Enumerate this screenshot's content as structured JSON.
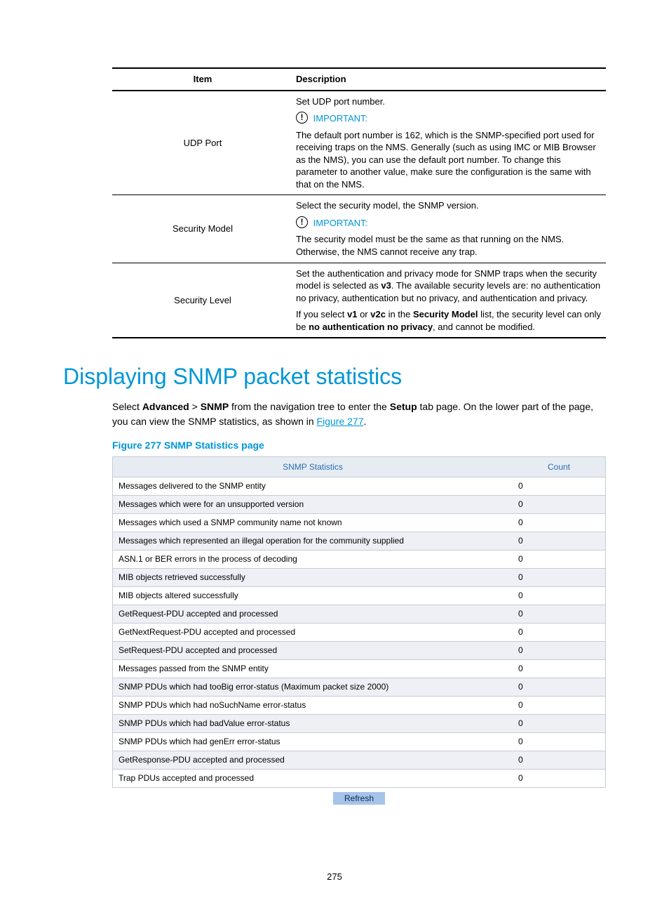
{
  "table1": {
    "headers": {
      "item": "Item",
      "desc": "Description"
    },
    "rows": [
      {
        "item": "UDP Port",
        "set": "Set UDP port number.",
        "imp": "IMPORTANT:",
        "body": "The default port number is 162, which is the SNMP-specified port used for receiving traps on the NMS. Generally (such as using IMC or MIB Browser as the NMS), you can use the default port number. To change this parameter to another value, make sure the configuration is the same with that on the NMS."
      },
      {
        "item": "Security Model",
        "set": "Select the security model, the SNMP version.",
        "imp": "IMPORTANT:",
        "body": "The security model must be the same as that running on the NMS. Otherwise, the NMS cannot receive any trap."
      },
      {
        "item": "Security Level",
        "b1a": "Set the authentication and privacy mode for SNMP traps when the security model is selected as ",
        "b1b_bold": "v3",
        "b1c": ". The available security levels are: no authentication no privacy, authentication but no privacy, and authentication and privacy.",
        "b2a": "If you select ",
        "b2b_bold": "v1",
        "b2c": " or ",
        "b2d_bold": "v2c",
        "b2e": " in the ",
        "b2f_bold": "Security Model",
        "b2g": " list, the security level can only be ",
        "b2h_bold": "no authentication no privacy",
        "b2i": ", and cannot be modified."
      }
    ]
  },
  "section_heading": "Displaying SNMP packet statistics",
  "paragraph": {
    "a": "Select ",
    "b_bold": "Advanced",
    "c": " > ",
    "d_bold": "SNMP",
    "e": " from the navigation tree to enter the ",
    "f_bold": "Setup",
    "g": " tab page. On the lower part of the page, you can view the SNMP statistics, as shown in ",
    "h_link": "Figure 277",
    "i": "."
  },
  "figure_caption": "Figure 277 SNMP Statistics page",
  "stats": {
    "headers": {
      "name": "SNMP Statistics",
      "count": "Count"
    },
    "rows": [
      {
        "name": "Messages delivered to the SNMP entity",
        "count": "0"
      },
      {
        "name": "Messages which were for an unsupported version",
        "count": "0"
      },
      {
        "name": "Messages which used a SNMP community name not known",
        "count": "0"
      },
      {
        "name": "Messages which represented an illegal operation for the community supplied",
        "count": "0"
      },
      {
        "name": "ASN.1 or BER errors in the process of decoding",
        "count": "0"
      },
      {
        "name": "MIB objects retrieved successfully",
        "count": "0"
      },
      {
        "name": "MIB objects altered successfully",
        "count": "0"
      },
      {
        "name": "GetRequest-PDU accepted and processed",
        "count": "0"
      },
      {
        "name": "GetNextRequest-PDU accepted and processed",
        "count": "0"
      },
      {
        "name": "SetRequest-PDU accepted and processed",
        "count": "0"
      },
      {
        "name": "Messages passed from the SNMP entity",
        "count": "0"
      },
      {
        "name": "SNMP PDUs which had tooBig error-status (Maximum packet size 2000)",
        "count": "0"
      },
      {
        "name": "SNMP PDUs which had noSuchName error-status",
        "count": "0"
      },
      {
        "name": "SNMP PDUs which had badValue error-status",
        "count": "0"
      },
      {
        "name": "SNMP PDUs which had genErr error-status",
        "count": "0"
      },
      {
        "name": "GetResponse-PDU accepted and processed",
        "count": "0"
      },
      {
        "name": "Trap PDUs accepted and processed",
        "count": "0"
      }
    ]
  },
  "refresh_label": "Refresh",
  "page_number": "275"
}
